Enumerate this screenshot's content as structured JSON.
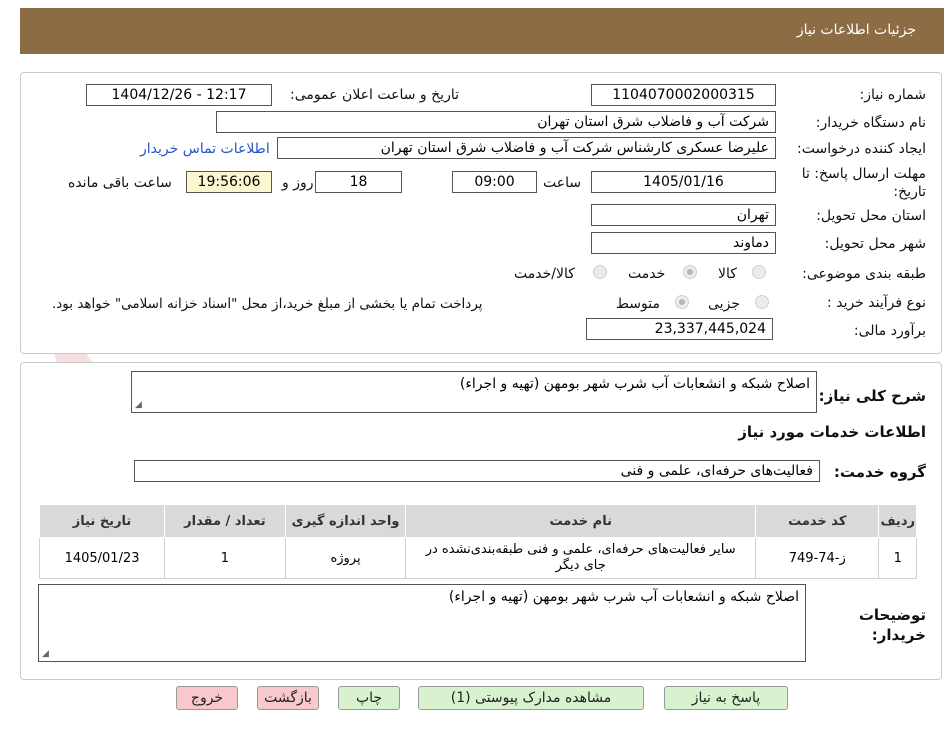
{
  "header": {
    "title": "جزئیات اطلاعات نیاز"
  },
  "watermark": {
    "text": "AriaTender.net"
  },
  "form": {
    "need_number_label": "شماره نیاز:",
    "need_number": "1104070002000315",
    "announce_label": "تاریخ و ساعت اعلان عمومی:",
    "announce_value": "1404/12/26 - 12:17",
    "buyer_org_label": "نام دستگاه خریدار:",
    "buyer_org": "شرکت آب و فاضلاب شرق استان تهران",
    "requester_label": "ایجاد کننده درخواست:",
    "requester": "علیرضا عسکری کارشناس شرکت آب و فاضلاب شرق استان تهران",
    "contact_link": "اطلاعات تماس خریدار",
    "deadline_label": "مهلت ارسال پاسخ: تا تاریخ:",
    "deadline_date": "1405/01/16",
    "time_label": "ساعت",
    "deadline_time": "09:00",
    "days_value": "18",
    "days_label": "روز و",
    "remaining_time": "19:56:06",
    "remaining_label": "ساعت باقی مانده",
    "province_label": "استان محل تحویل:",
    "province": "تهران",
    "city_label": "شهر محل تحویل:",
    "city": "دماوند",
    "category_label": "طبقه بندی موضوعی:",
    "category_options": [
      "کالا",
      "خدمت",
      "کالا/خدمت"
    ],
    "category_selected": "خدمت",
    "process_label": "نوع فرآیند خرید :",
    "process_options": [
      "جزیی",
      "متوسط"
    ],
    "process_selected": "متوسط",
    "process_note": "پرداخت تمام یا بخشی از مبلغ خرید،از محل \"اسناد خزانه اسلامی\" خواهد بود.",
    "budget_label": "برآورد مالی:",
    "budget": "23,337,445,024"
  },
  "summary": {
    "label": "شرح کلی نیاز:",
    "value": "اصلاح شبکه و انشعابات آب شرب شهر بومهن (تهیه و اجراء)"
  },
  "services": {
    "section_title": "اطلاعات خدمات مورد نیاز",
    "group_label": "گروه خدمت:",
    "group_value": "فعالیت‌های حرفه‌ای، علمی و فنی",
    "columns": [
      "ردیف",
      "کد خدمت",
      "نام خدمت",
      "واحد اندازه گیری",
      "تعداد / مقدار",
      "تاریخ نیاز"
    ],
    "rows": [
      {
        "row": "1",
        "code": "ز-74-749",
        "name": "سایر فعالیت‌های حرفه‌ای، علمی و فنی طبقه‌بندی‌نشده در جای دیگر",
        "unit": "پروژه",
        "qty": "1",
        "date": "1405/01/23"
      }
    ]
  },
  "buyer_notes": {
    "label": "توضیحات خریدار:",
    "value": "اصلاح شبکه و انشعابات آب شرب شهر بومهن (تهیه و اجراء)"
  },
  "buttons": {
    "reply": "پاسخ به نیاز",
    "attachments": "مشاهده مدارک پیوستی (1)",
    "print": "چاپ",
    "back": "بازگشت",
    "exit": "خروج"
  },
  "colors": {
    "header_bg": "#8b6c44",
    "link": "#2255cc",
    "remaining_bg": "#fbf7cf",
    "green_btn": "#d8f2d0",
    "red_btn": "#f9c8cc"
  }
}
